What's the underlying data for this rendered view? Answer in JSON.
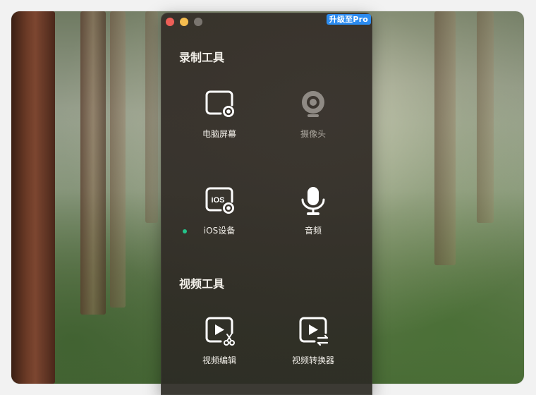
{
  "app": {
    "upgrade_badge": "升级至Pro"
  },
  "sections": {
    "record": {
      "title": "录制工具",
      "tools": [
        {
          "label": "电脑屏幕",
          "icon": "screen-record-icon"
        },
        {
          "label": "摄像头",
          "icon": "webcam-icon"
        },
        {
          "label": "iOS设备",
          "icon": "ios-device-icon",
          "icon_text": "iOS"
        },
        {
          "label": "音频",
          "icon": "microphone-icon"
        }
      ]
    },
    "video": {
      "title": "视频工具",
      "tools": [
        {
          "label": "视频编辑",
          "icon": "video-edit-icon"
        },
        {
          "label": "视频转换器",
          "icon": "video-convert-icon"
        }
      ]
    }
  },
  "colors": {
    "badge": "#2c8cf0",
    "status_dot": "#24c48a",
    "close": "#ed5f57",
    "minimize": "#f5bd4f"
  }
}
